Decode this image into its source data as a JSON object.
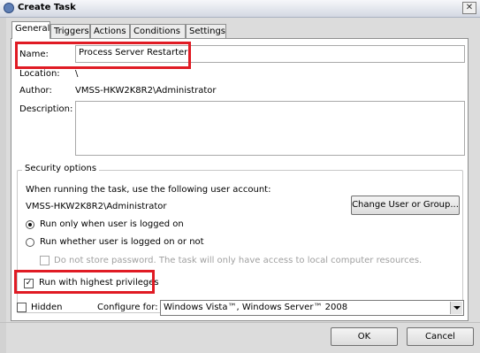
{
  "window": {
    "title": "Create Task",
    "close_glyph": "✕",
    "icon": "task-scheduler-icon"
  },
  "tabs": [
    {
      "label": "General",
      "active": true
    },
    {
      "label": "Triggers",
      "active": false
    },
    {
      "label": "Actions",
      "active": false
    },
    {
      "label": "Conditions",
      "active": false
    },
    {
      "label": "Settings",
      "active": false
    }
  ],
  "general": {
    "name_label": "Name:",
    "name_value": "Process Server Restarter",
    "location_label": "Location:",
    "location_value": "\\",
    "author_label": "Author:",
    "author_value": "VMSS-HKW2K8R2\\Administrator",
    "description_label": "Description:",
    "description_value": ""
  },
  "security": {
    "legend": "Security options",
    "account_prompt": "When running the task, use the following user account:",
    "account_value": "VMSS-HKW2K8R2\\Administrator",
    "change_user_button": "Change User or Group...",
    "radio_logged_on": "Run only when user is logged on",
    "radio_logged_on_checked": true,
    "radio_whether": "Run whether user is logged on or not",
    "radio_whether_checked": false,
    "no_store_password": "Do not store password.  The task will only have access to local computer resources.",
    "highest_privileges": "Run with highest privileges",
    "highest_privileges_checked": true
  },
  "bottom": {
    "hidden_label": "Hidden",
    "configure_label": "Configure for:",
    "configure_value": "Windows Vista™, Windows Server™ 2008"
  },
  "buttons": {
    "ok": "OK",
    "cancel": "Cancel"
  },
  "colors": {
    "highlight": "#e01b24"
  }
}
